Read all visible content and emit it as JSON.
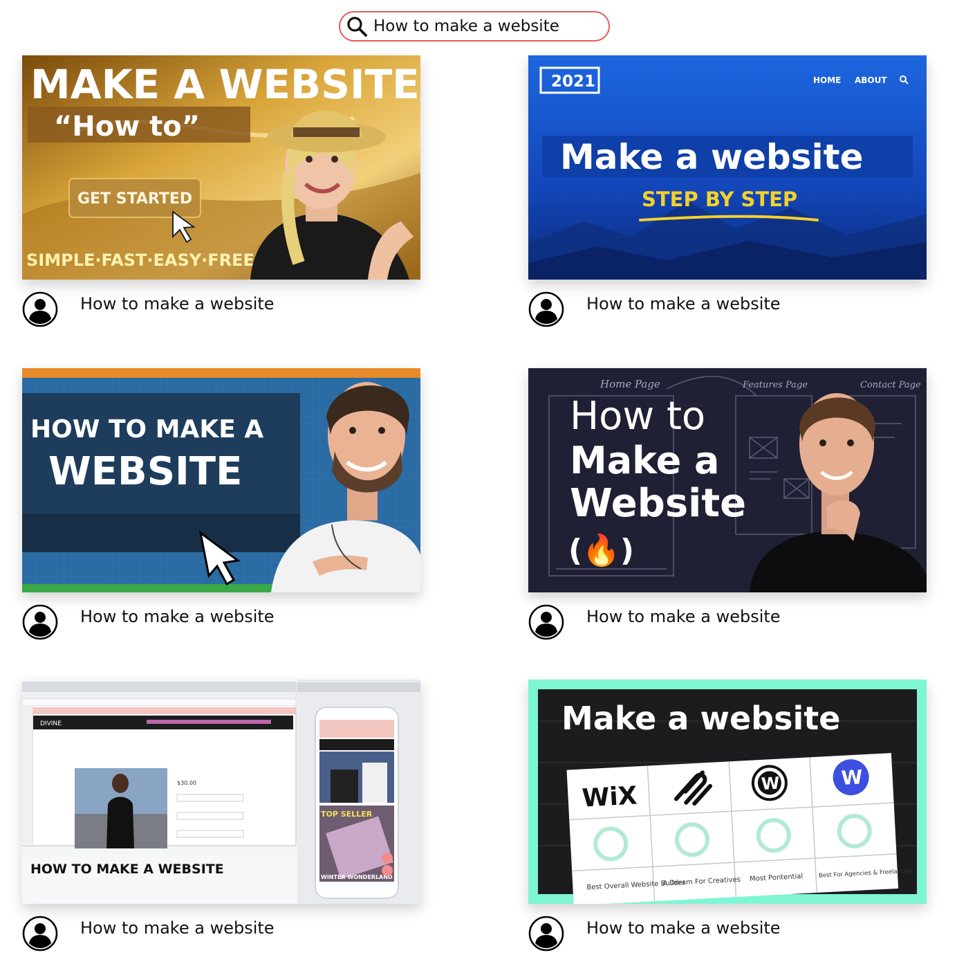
{
  "search": {
    "icon": "search-icon",
    "value": "How to make a website",
    "border_color": "#e25b5b"
  },
  "videos": [
    {
      "title": "How to make a website",
      "thumbnail": {
        "headline": "MAKE A WEBSITE",
        "subhead": "“How to”",
        "button": "GET STARTED",
        "footer": "SIMPLE·FAST·EASY·FREE"
      }
    },
    {
      "title": "How to make a website",
      "thumbnail": {
        "badge": "2021",
        "nav_home": "HOME",
        "nav_about": "ABOUT",
        "headline": "Make a website",
        "subhead": "STEP BY STEP"
      }
    },
    {
      "title": "How to make a website",
      "thumbnail": {
        "line1": "HOW TO MAKE A",
        "line2": "WEBSITE"
      }
    },
    {
      "title": "How to make a website",
      "thumbnail": {
        "sketch_home": "Home Page",
        "sketch_features": "Features Page",
        "sketch_contact": "Contact Page",
        "line1": "How to",
        "line2": "Make a",
        "line3": "Website",
        "logo": "(🔥)"
      }
    },
    {
      "title": "How to make a website",
      "thumbnail": {
        "caption": "HOW TO MAKE A WEBSITE",
        "brand": "DIVINE",
        "price": "$30.00",
        "promo_top": "TOP SELLER",
        "promo_winter": "WINTER WONDERLAND"
      }
    },
    {
      "title": "How to make a website",
      "thumbnail": {
        "headline": "Make a website",
        "logo_wix": "WiX",
        "logo_w": "W",
        "label1": "Best Overall Website Builder",
        "label2": "A Dream For Creatives",
        "label3": "Most Pontential",
        "label4": "Best For Agencies & Freelancers",
        "frame_color": "#7ef5d4"
      }
    }
  ]
}
